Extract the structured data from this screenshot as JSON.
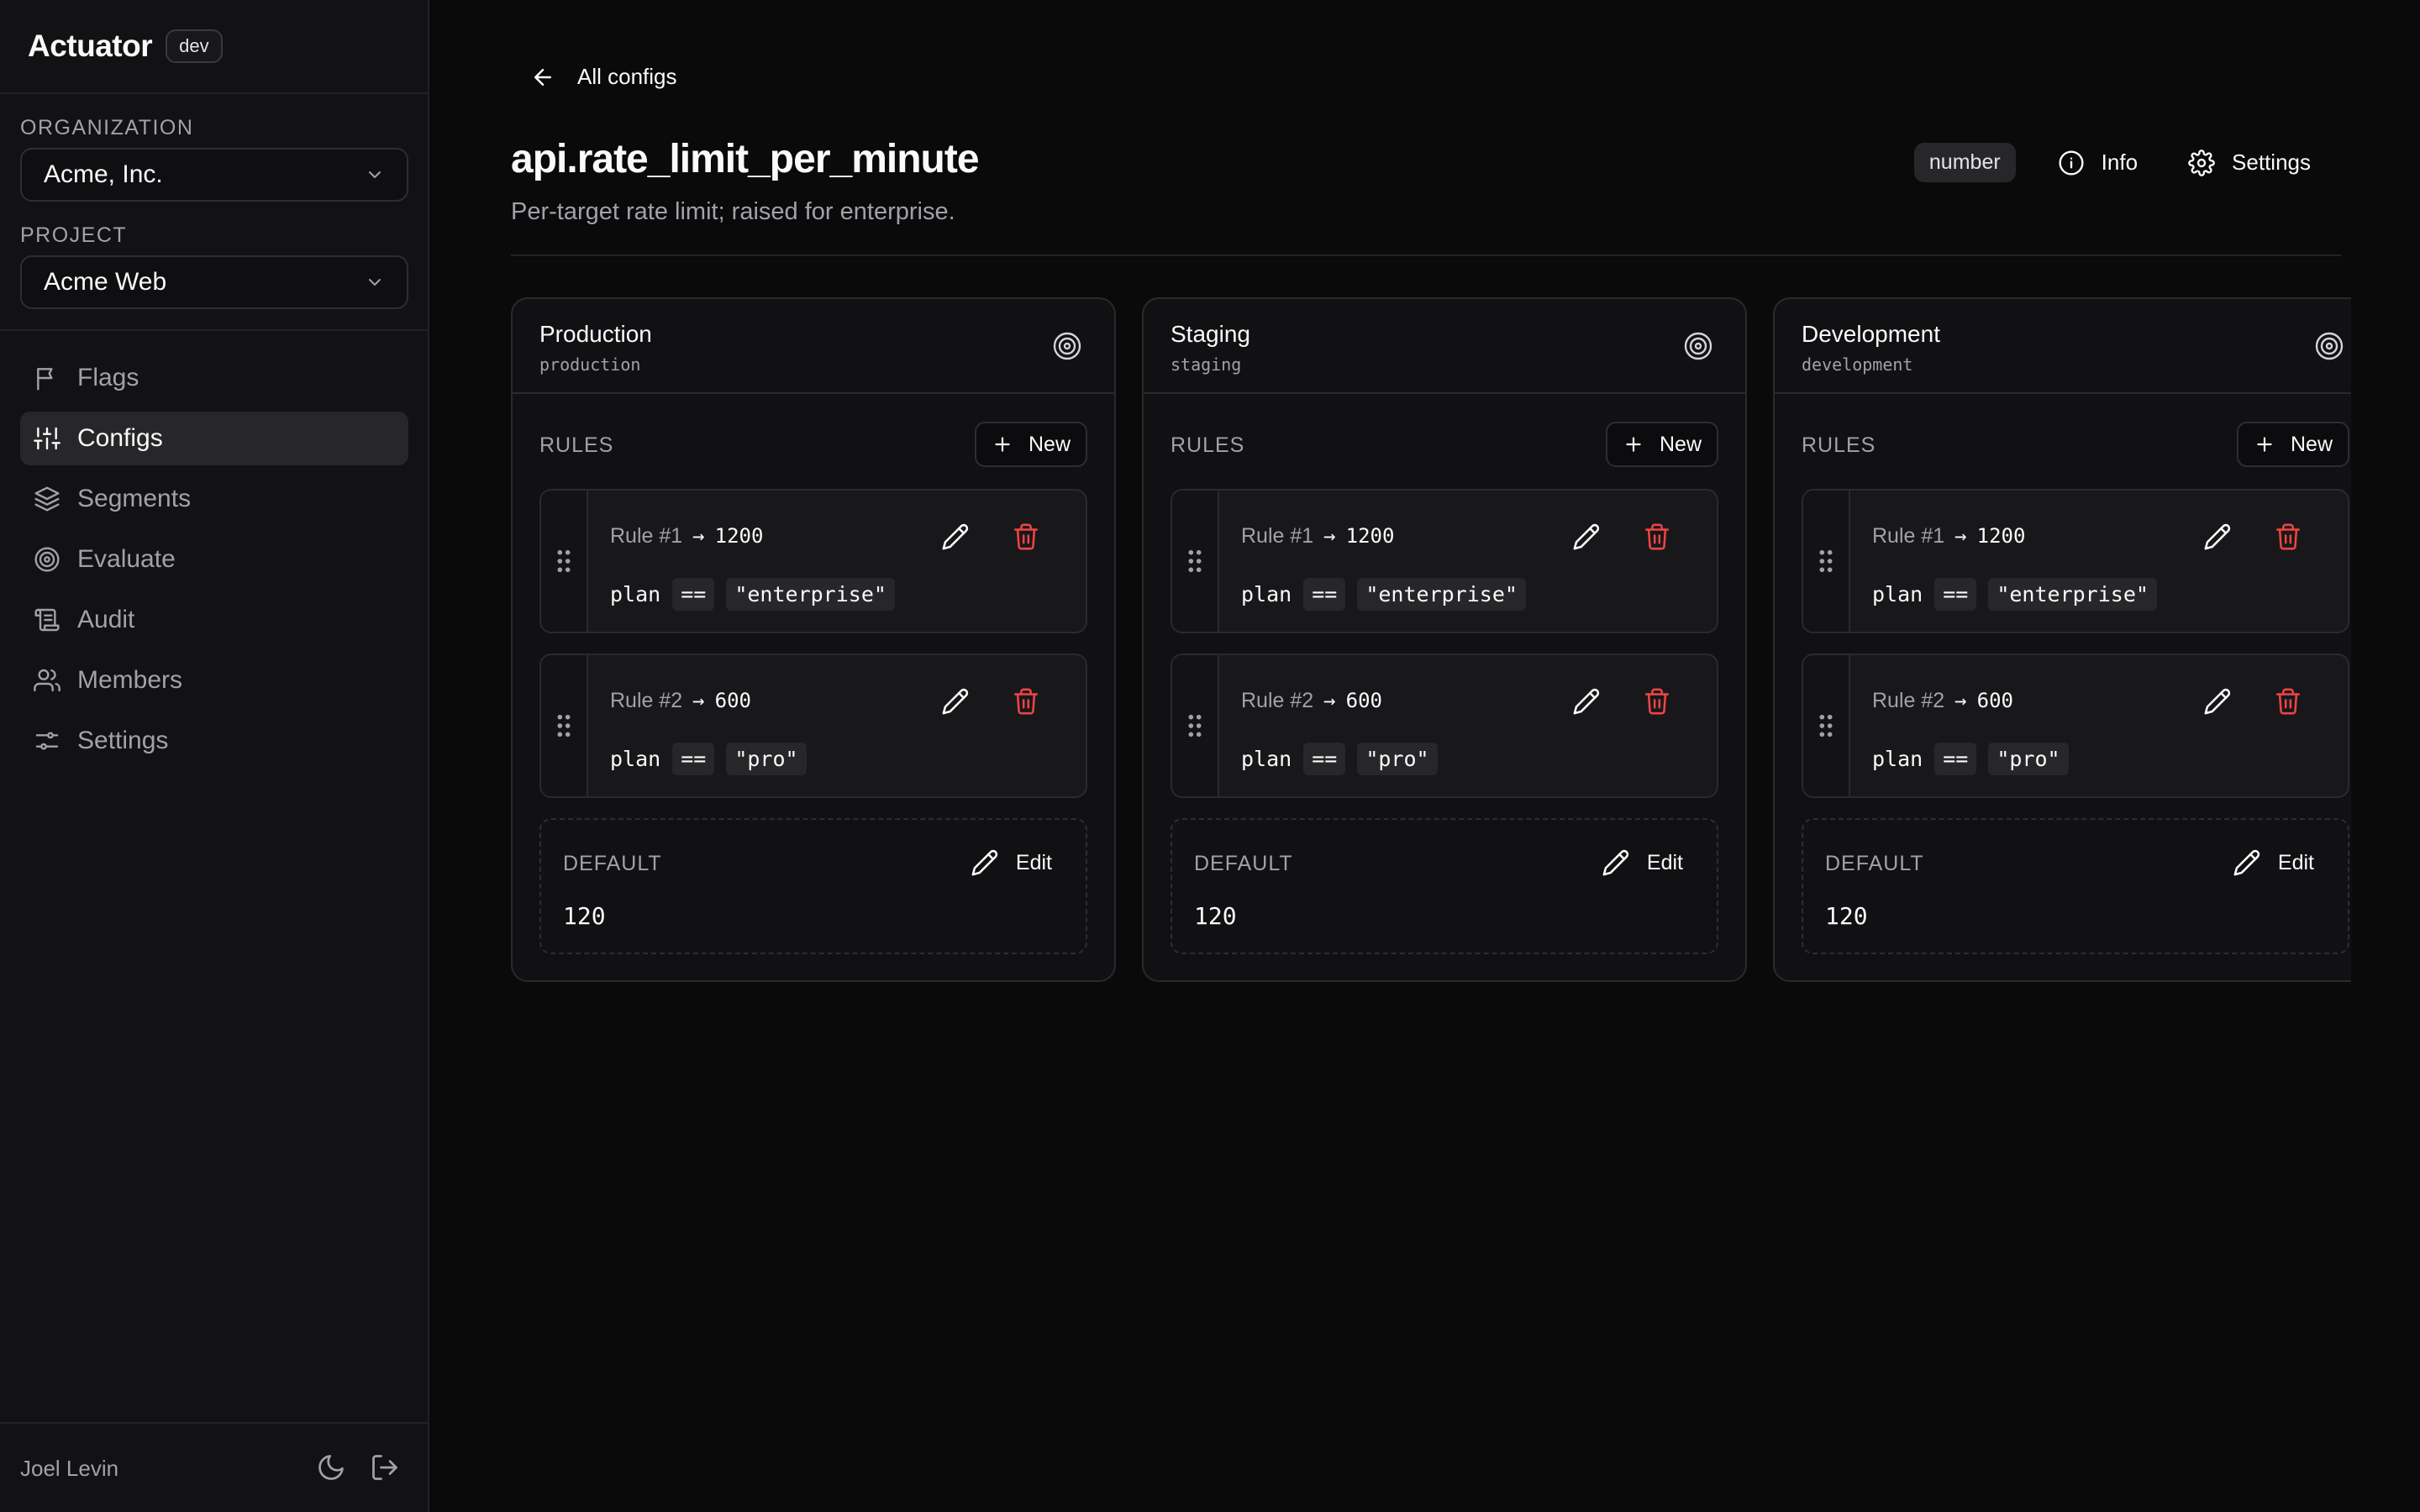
{
  "sidebar": {
    "brand": "Actuator",
    "env_badge": "dev",
    "org_label": "ORGANIZATION",
    "org_value": "Acme, Inc.",
    "project_label": "PROJECT",
    "project_value": "Acme Web",
    "nav": [
      {
        "label": "Flags",
        "icon": "flag-icon"
      },
      {
        "label": "Configs",
        "icon": "sliders-icon",
        "active": true
      },
      {
        "label": "Segments",
        "icon": "layers-icon"
      },
      {
        "label": "Evaluate",
        "icon": "target-icon"
      },
      {
        "label": "Audit",
        "icon": "scroll-icon"
      },
      {
        "label": "Members",
        "icon": "users-icon"
      },
      {
        "label": "Settings",
        "icon": "settings-sliders-icon"
      }
    ],
    "user": "Joel Levin"
  },
  "main": {
    "back_label": "All configs",
    "title": "api.rate_limit_per_minute",
    "description": "Per-target rate limit; raised for enterprise.",
    "type_badge": "number",
    "info_label": "Info",
    "settings_label": "Settings",
    "rules_label": "RULES",
    "new_label": "New",
    "default_label": "DEFAULT",
    "edit_label": "Edit",
    "environments": [
      {
        "name": "Production",
        "key": "production",
        "rules": [
          {
            "num": "Rule #1",
            "value": "1200",
            "attr": "plan",
            "op": "==",
            "match": "\"enterprise\""
          },
          {
            "num": "Rule #2",
            "value": "600",
            "attr": "plan",
            "op": "==",
            "match": "\"pro\""
          }
        ],
        "default": "120"
      },
      {
        "name": "Staging",
        "key": "staging",
        "rules": [
          {
            "num": "Rule #1",
            "value": "1200",
            "attr": "plan",
            "op": "==",
            "match": "\"enterprise\""
          },
          {
            "num": "Rule #2",
            "value": "600",
            "attr": "plan",
            "op": "==",
            "match": "\"pro\""
          }
        ],
        "default": "120"
      },
      {
        "name": "Development",
        "key": "development",
        "rules": [
          {
            "num": "Rule #1",
            "value": "1200",
            "attr": "plan",
            "op": "==",
            "match": "\"enterprise\""
          },
          {
            "num": "Rule #2",
            "value": "600",
            "attr": "plan",
            "op": "==",
            "match": "\"pro\""
          }
        ],
        "default": "120"
      }
    ]
  },
  "colors": {
    "background": "#0a0a0b",
    "sidebar": "#121214",
    "danger": "#ef4444",
    "muted_text": "#a1a1aa"
  }
}
